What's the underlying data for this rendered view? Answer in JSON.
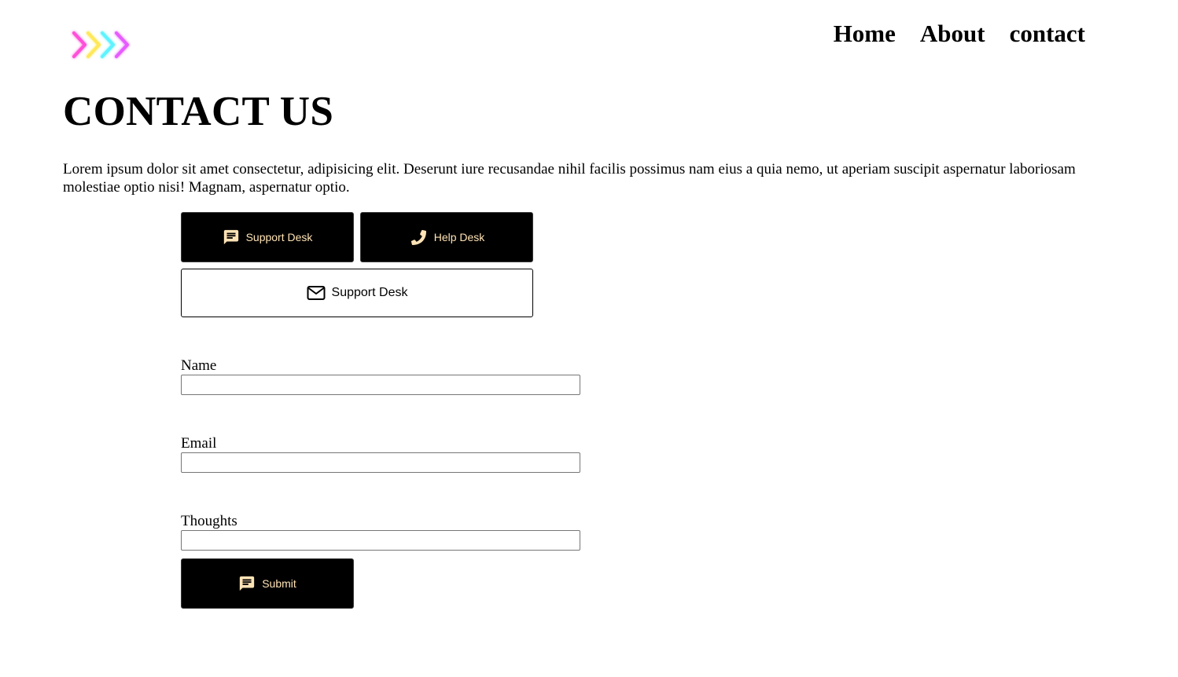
{
  "header": {
    "logo_icon": "neon-chevrons-logo-icon",
    "nav": {
      "home": "Home",
      "about": "About",
      "contact": "contact"
    }
  },
  "main": {
    "title": "CONTACT US",
    "intro": "Lorem ipsum dolor sit amet consectetur, adipisicing elit. Deserunt iure recusandae nihil facilis possimus nam eius a quia nemo, ut aperiam suscipit aspernatur laboriosam molestiae optio nisi! Magnam, aspernatur optio.",
    "buttons": {
      "support_desk": {
        "label": "Support Desk",
        "icon": "chat-icon"
      },
      "help_desk": {
        "label": "Help Desk",
        "icon": "phone-icon"
      },
      "email_support": {
        "label": "Support Desk",
        "icon": "mail-icon"
      }
    },
    "form": {
      "name_label": "Name",
      "name_value": "",
      "email_label": "Email",
      "email_value": "",
      "thoughts_label": "Thoughts",
      "thoughts_value": "",
      "submit": {
        "label": "Submit",
        "icon": "chat-icon"
      }
    }
  },
  "colors": {
    "dark_button_bg": "#000000",
    "dark_button_text": "#ffe3b5",
    "logo_pink": "#ff4fd8",
    "logo_yellow": "#ffe85a",
    "logo_cyan": "#5ff3ff",
    "logo_magenta": "#e65cff"
  }
}
